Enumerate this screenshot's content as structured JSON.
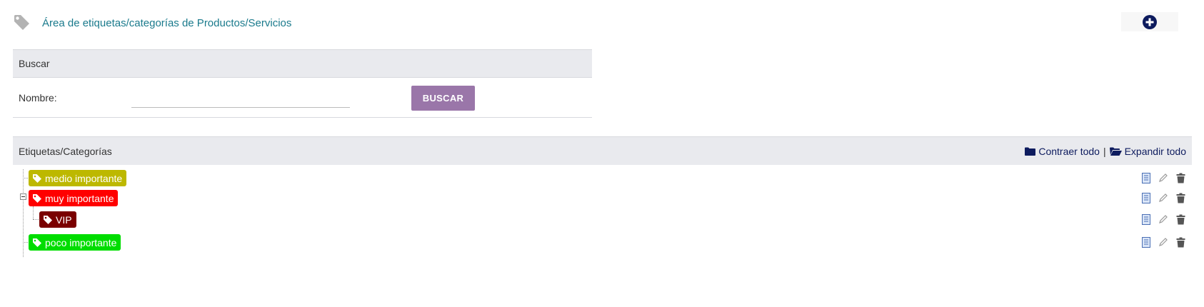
{
  "header": {
    "title": "Área de etiquetas/categorías de Productos/Servicios",
    "add_icon": "plus-circle-icon"
  },
  "search": {
    "heading": "Buscar",
    "name_label": "Nombre:",
    "name_value": "",
    "button_label": "BUSCAR"
  },
  "tree": {
    "heading": "Etiquetas/Categorías",
    "collapse_label": "Contraer todo",
    "separator": "|",
    "expand_label": "Expandir todo",
    "nodes": [
      {
        "label": "medio importante",
        "color": "#bdb800",
        "level": 0
      },
      {
        "label": "muy importante",
        "color": "#ff0000",
        "level": 0,
        "expanded": true
      },
      {
        "label": "VIP",
        "color": "#7a0000",
        "level": 1
      },
      {
        "label": "poco importante",
        "color": "#00dd00",
        "level": 0
      }
    ],
    "row_icons": [
      "document-icon",
      "pencil-icon",
      "trash-icon"
    ]
  },
  "colors": {
    "title_teal": "#1a7a8c",
    "navy": "#0d1b5e",
    "search_button": "#9a76a9",
    "panel_header": "#e9eaee"
  }
}
